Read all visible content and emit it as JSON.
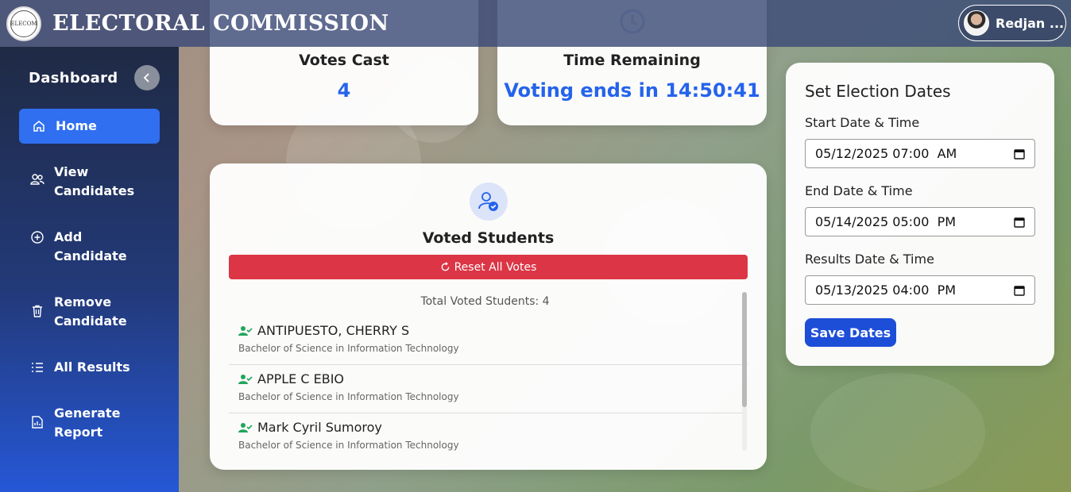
{
  "header": {
    "brand": "ELECTORAL COMMISSION",
    "logo_text": "ELECOM",
    "user_name": "Redjan ..."
  },
  "sidebar": {
    "title": "Dashboard",
    "items": [
      {
        "line1": "Home",
        "line2": "",
        "icon": "home-icon",
        "active": true
      },
      {
        "line1": "View",
        "line2": "Candidates",
        "icon": "users-icon"
      },
      {
        "line1": "Add",
        "line2": "Candidate",
        "icon": "plus-circle-icon"
      },
      {
        "line1": "Remove",
        "line2": "Candidate",
        "icon": "trash-icon"
      },
      {
        "line1": "All Results",
        "line2": "",
        "icon": "list-icon"
      },
      {
        "line1": "Generate",
        "line2": "Report",
        "icon": "report-icon"
      }
    ]
  },
  "stats": {
    "votes_cast_title": "Votes Cast",
    "votes_cast_value": "4",
    "time_title": "Time Remaining",
    "time_value": "Voting ends in 14:50:41"
  },
  "voted": {
    "title": "Voted Students",
    "reset_label": "Reset All Votes",
    "total_label": "Total Voted Students: 4",
    "students": [
      {
        "name": "ANTIPUESTO, CHERRY S",
        "course": "Bachelor of Science in Information Technology"
      },
      {
        "name": "APPLE C EBIO",
        "course": "Bachelor of Science in Information Technology"
      },
      {
        "name": "Mark Cyril Sumoroy",
        "course": "Bachelor of Science in Information Technology"
      }
    ]
  },
  "dates": {
    "title": "Set Election Dates",
    "start_label": "Start Date & Time",
    "start_value": "05/12/2025 07:00  AM",
    "end_label": "End Date & Time",
    "end_value": "05/14/2025 05:00  PM",
    "results_label": "Results Date & Time",
    "results_value": "05/13/2025 04:00  PM",
    "save_label": "Save Dates"
  },
  "colors": {
    "accent": "#2563eb",
    "danger": "#dc3545",
    "success": "#22a55a"
  }
}
